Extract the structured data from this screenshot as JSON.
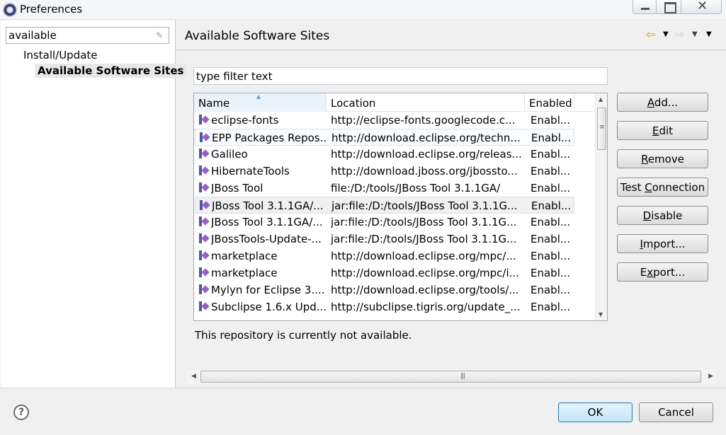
{
  "window": {
    "title": "Preferences",
    "close_glyph": "✕"
  },
  "left": {
    "filter_value": "available",
    "clear_icon": "✎",
    "tree": [
      {
        "label": "Install/Update"
      },
      {
        "label": "Available Software Sites"
      }
    ]
  },
  "page": {
    "title": "Available Software Sites",
    "filter_placeholder": "type filter text",
    "status": "This repository is currently not available."
  },
  "nav": {
    "back_glyph": "⇦",
    "fwd_glyph": "⇨",
    "dropdown_glyph": "▼"
  },
  "table": {
    "columns": [
      "Name",
      "Location",
      "Enabled"
    ],
    "sort_glyph": "▲",
    "rows": [
      {
        "name": "eclipse-fonts",
        "location": "http://eclipse-fonts.googlecode.c...",
        "enabled": "Enabl..."
      },
      {
        "name": "EPP Packages Repos...",
        "location": "http://download.eclipse.org/techn...",
        "enabled": "Enabl..."
      },
      {
        "name": "Galileo",
        "location": "http://download.eclipse.org/releas...",
        "enabled": "Enabl..."
      },
      {
        "name": "HibernateTools",
        "location": "http://download.jboss.org/jbossto...",
        "enabled": "Enabl..."
      },
      {
        "name": "JBoss Tool",
        "location": "file:/D:/tools/JBoss Tool 3.1.1GA/",
        "enabled": "Enabl..."
      },
      {
        "name": "JBoss Tool 3.1.1GA/...",
        "location": "jar:file:/D:/tools/JBoss Tool 3.1.1G...",
        "enabled": "Enabl..."
      },
      {
        "name": "JBoss Tool 3.1.1GA/...",
        "location": "jar:file:/D:/tools/JBoss Tool 3.1.1G...",
        "enabled": "Enabl..."
      },
      {
        "name": "JBossTools-Update-...",
        "location": "jar:file:/D:/tools/JBoss Tool 3.1.1G...",
        "enabled": "Enabl..."
      },
      {
        "name": "marketplace",
        "location": "http://download.eclipse.org/mpc/...",
        "enabled": "Enabl..."
      },
      {
        "name": "marketplace",
        "location": "http://download.eclipse.org/mpc/i...",
        "enabled": "Enabl..."
      },
      {
        "name": "Mylyn for Eclipse 3....",
        "location": "http://download.eclipse.org/tools/...",
        "enabled": "Enabl..."
      },
      {
        "name": "Subclipse 1.6.x Upd...",
        "location": "http://subclipse.tigris.org/update_...",
        "enabled": "Enabl..."
      }
    ]
  },
  "buttons": {
    "add": {
      "pre": "",
      "mn": "A",
      "post": "dd..."
    },
    "edit": {
      "pre": "",
      "mn": "E",
      "post": "dit"
    },
    "remove": {
      "pre": "",
      "mn": "R",
      "post": "emove"
    },
    "test": {
      "pre": "Test ",
      "mn": "C",
      "post": "onnection"
    },
    "disable": {
      "pre": "",
      "mn": "D",
      "post": "isable"
    },
    "import": {
      "pre": "",
      "mn": "I",
      "post": "mport..."
    },
    "export": {
      "pre": "E",
      "mn": "x",
      "post": "port..."
    }
  },
  "scroll": {
    "up": "▲",
    "down": "▼",
    "left": "◀",
    "right": "▶",
    "grip_v": "≡",
    "grip_h": "|||"
  },
  "footer": {
    "help": "?",
    "ok": "OK",
    "cancel": "Cancel"
  }
}
